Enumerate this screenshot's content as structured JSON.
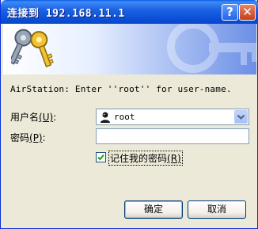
{
  "window": {
    "title": "连接到 192.168.11.1",
    "help_label": "?",
    "close_label": "✕"
  },
  "banner": {
    "icon": "keys-icon"
  },
  "prompt": {
    "message": "AirStation: Enter ''root'' for user-name."
  },
  "form": {
    "username_label": "用户名",
    "username_accel": "(U)",
    "username_suffix": ":",
    "username_value": "root",
    "password_label": "密码",
    "password_accel": "(P)",
    "password_suffix": ":",
    "password_value": "",
    "remember_label": "记住我的密码",
    "remember_accel": "(R)",
    "remember_checked": true
  },
  "buttons": {
    "ok_label": "确定",
    "cancel_label": "取消"
  }
}
